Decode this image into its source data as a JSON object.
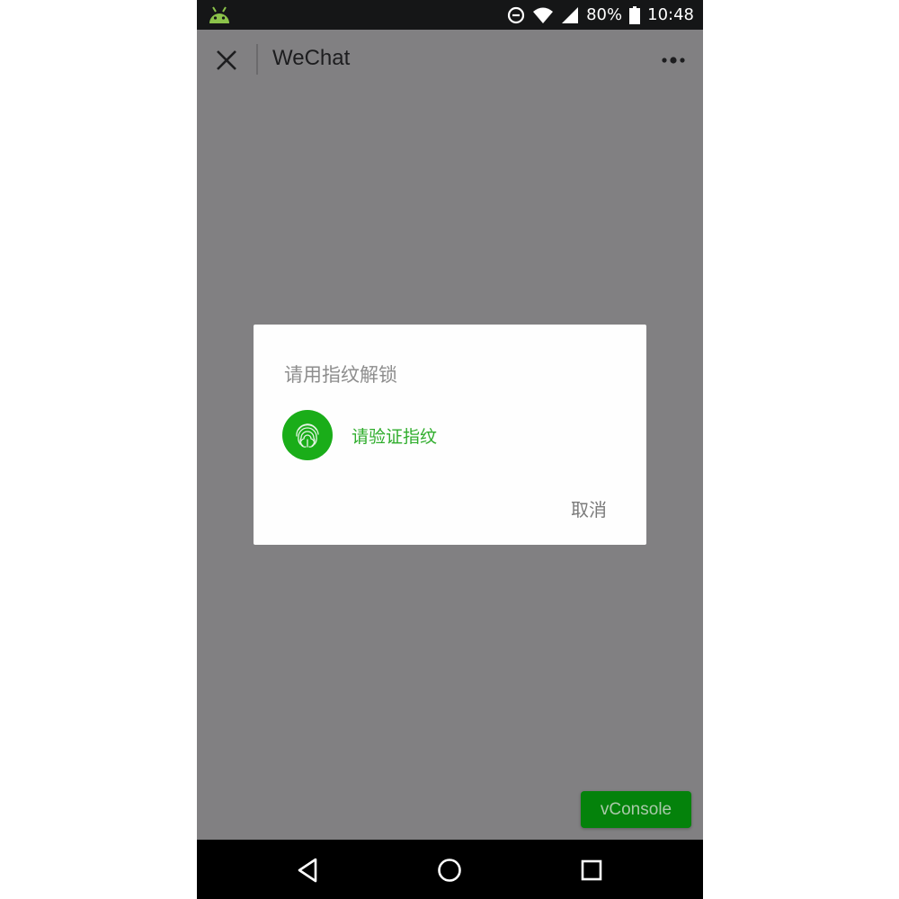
{
  "status_bar": {
    "battery_percent": "80%",
    "time": "10:48",
    "icons": [
      "android-icon",
      "data-saver-icon",
      "wifi-icon",
      "signal-icon",
      "battery-icon"
    ]
  },
  "title_bar": {
    "title": "WeChat",
    "icons": [
      "close-icon",
      "more-icon"
    ]
  },
  "dialog": {
    "title": "请用指纹解锁",
    "prompt": "请验证指纹",
    "cancel_label": "取消",
    "accent_color": "#1aad19",
    "icon": "fingerprint-icon"
  },
  "vconsole": {
    "label": "vConsole"
  },
  "nav_bar": {
    "icons": [
      "back-icon",
      "home-icon",
      "recents-icon"
    ]
  },
  "colors": {
    "overlay": "#818082",
    "status_bar": "#151617",
    "vconsole_bg": "#04820b"
  }
}
